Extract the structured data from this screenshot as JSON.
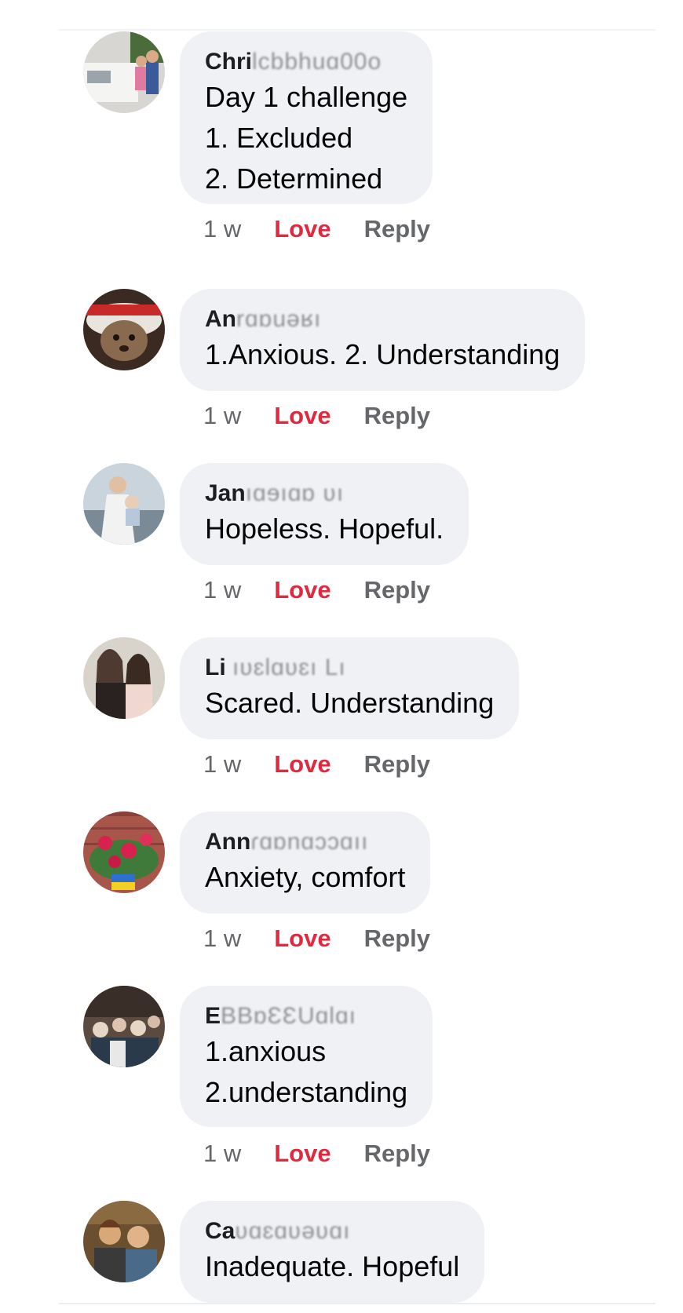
{
  "comments": [
    {
      "author": "Chri",
      "author_obscured": "lcbbhuɑ00o",
      "lines": [
        "Day 1 challenge",
        "1. Excluded",
        "2. Determined"
      ],
      "age": "1 w",
      "love": "Love",
      "reply": "Reply",
      "avatar_colors": [
        "#d8d6d2",
        "#f4f4f2",
        "#4a6b3a"
      ]
    },
    {
      "author": "An",
      "author_obscured": "rɑɒuəʁı",
      "lines": [
        "1.Anxious.  2. Understanding"
      ],
      "age": "1 w",
      "love": "Love",
      "reply": "Reply",
      "avatar_colors": [
        "#3a2a22",
        "#e8e4de",
        "#8a6a4e"
      ]
    },
    {
      "author": "Jan",
      "author_obscured": "ıɑɘıɑɒ ʋı",
      "lines": [
        "Hopeless. Hopeful."
      ],
      "age": "1 w",
      "love": "Love",
      "reply": "Reply",
      "avatar_colors": [
        "#c9d4dc",
        "#f2f2f2",
        "#7a8a96"
      ]
    },
    {
      "author": "Li",
      "author_obscured": "ıʋɛlɑʋɛı Lı",
      "lines": [
        "Scared. Understanding"
      ],
      "age": "1 w",
      "love": "Love",
      "reply": "Reply",
      "avatar_colors": [
        "#4e3a30",
        "#e6c8b8",
        "#2a2220"
      ]
    },
    {
      "author": "Ann",
      "author_obscured": "ɾɑɒnɑɔɔɑıı",
      "lines": [
        "Anxiety, comfort"
      ],
      "age": "1 w",
      "love": "Love",
      "reply": "Reply",
      "avatar_colors": [
        "#a8554a",
        "#d9214f",
        "#3f7a3a"
      ]
    },
    {
      "author": "E",
      "author_obscured": "BBɒƐƐUɑlɑı",
      "lines": [
        "1.anxious",
        "2.understanding"
      ],
      "age": "1 w",
      "love": "Love",
      "reply": "Reply",
      "avatar_colors": [
        "#5a4a40",
        "#e6d6c6",
        "#2a3a4a"
      ]
    },
    {
      "author": "Ca",
      "author_obscured": "ʋɑɛɑʋəʋɑı",
      "lines": [
        "Inadequate. Hopeful"
      ],
      "age": "",
      "love": "",
      "reply": "",
      "avatar_colors": [
        "#6a5030",
        "#d8a878",
        "#4a6a8a"
      ]
    }
  ]
}
